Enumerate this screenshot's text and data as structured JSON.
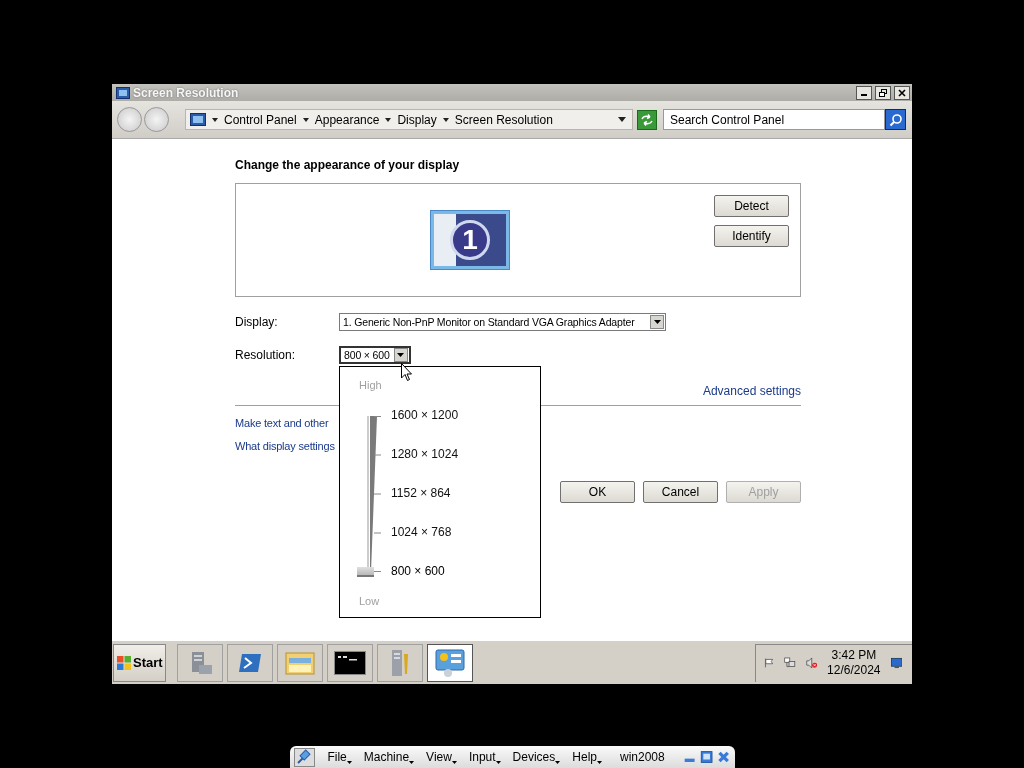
{
  "window": {
    "title": "Screen Resolution"
  },
  "address_bar": {
    "breadcrumbs": [
      "Control Panel",
      "Appearance",
      "Display",
      "Screen Resolution"
    ],
    "search": {
      "placeholder": "Search Control Panel"
    }
  },
  "heading": "Change the appearance of your display",
  "preview": {
    "monitor_number": "1",
    "buttons": [
      "Detect",
      "Identify"
    ]
  },
  "display": {
    "label": "Display:",
    "value": "1. Generic Non-PnP Monitor on Standard VGA Graphics Adapter"
  },
  "resolution": {
    "label": "Resolution:",
    "value": "800 × 600",
    "expanded": true,
    "high_label": "High",
    "low_label": "Low",
    "level": 0,
    "options": [
      {
        "label": "1600 × 1200",
        "selected": false
      },
      {
        "label": "1280 × 1024",
        "selected": false
      },
      {
        "label": "1152 × 864",
        "selected": false
      },
      {
        "label": "1024 × 768",
        "selected": false
      },
      {
        "label": "800 × 600",
        "selected": true
      }
    ]
  },
  "advanced_link": "Advanced settings",
  "links": [
    "Make text and other",
    "What display settings"
  ],
  "dialog_buttons": [
    {
      "label": "OK",
      "disabled": false
    },
    {
      "label": "Cancel",
      "disabled": false
    },
    {
      "label": "Apply",
      "disabled": true
    }
  ],
  "taskbar": {
    "start": "Start",
    "apps": [
      {
        "kind": "server",
        "active": false
      },
      {
        "kind": "shell",
        "active": false
      },
      {
        "kind": "folder",
        "active": false
      },
      {
        "kind": "console",
        "active": false
      },
      {
        "kind": "tools",
        "active": false
      },
      {
        "kind": "panel",
        "active": true
      }
    ],
    "time": "3:42 PM",
    "date": "12/6/2024"
  },
  "vm_toolbar": {
    "menus": [
      "File",
      "Machine",
      "View",
      "Input",
      "Devices",
      "Help"
    ],
    "vm_name": "win2008"
  }
}
